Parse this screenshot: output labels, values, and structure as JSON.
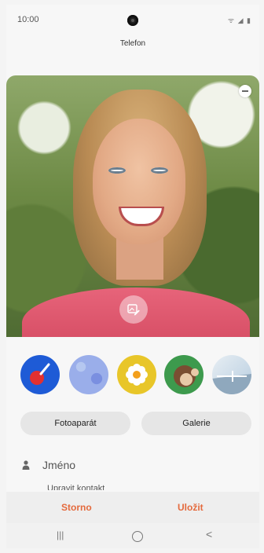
{
  "status_bar": {
    "time": "10:00",
    "icons": "ᯤ ◢ ▮"
  },
  "header": {
    "title": "Telefon"
  },
  "photo": {
    "edit_icon": "image-edit-icon",
    "remove_icon": "minus-icon"
  },
  "stickers": [
    {
      "name": "paintbrush-sticker",
      "color": "#1e5bd6"
    },
    {
      "name": "blue-pattern-sticker",
      "color": "#9aaeea"
    },
    {
      "name": "flower-sticker",
      "color": "#e8c629"
    },
    {
      "name": "monkey-sticker",
      "color": "#3d9a4d"
    },
    {
      "name": "landscape-sticker",
      "color": "#b7cde0"
    }
  ],
  "buttons": {
    "camera": "Fotoaparát",
    "gallery": "Galerie"
  },
  "name_field": {
    "placeholder": "Jméno"
  },
  "partial_text": "Upravit kontakt",
  "actions": {
    "cancel": "Storno",
    "save": "Uložit"
  },
  "nav": {
    "recents": "|||",
    "back": "<"
  },
  "accent_color": "#e46a3d"
}
